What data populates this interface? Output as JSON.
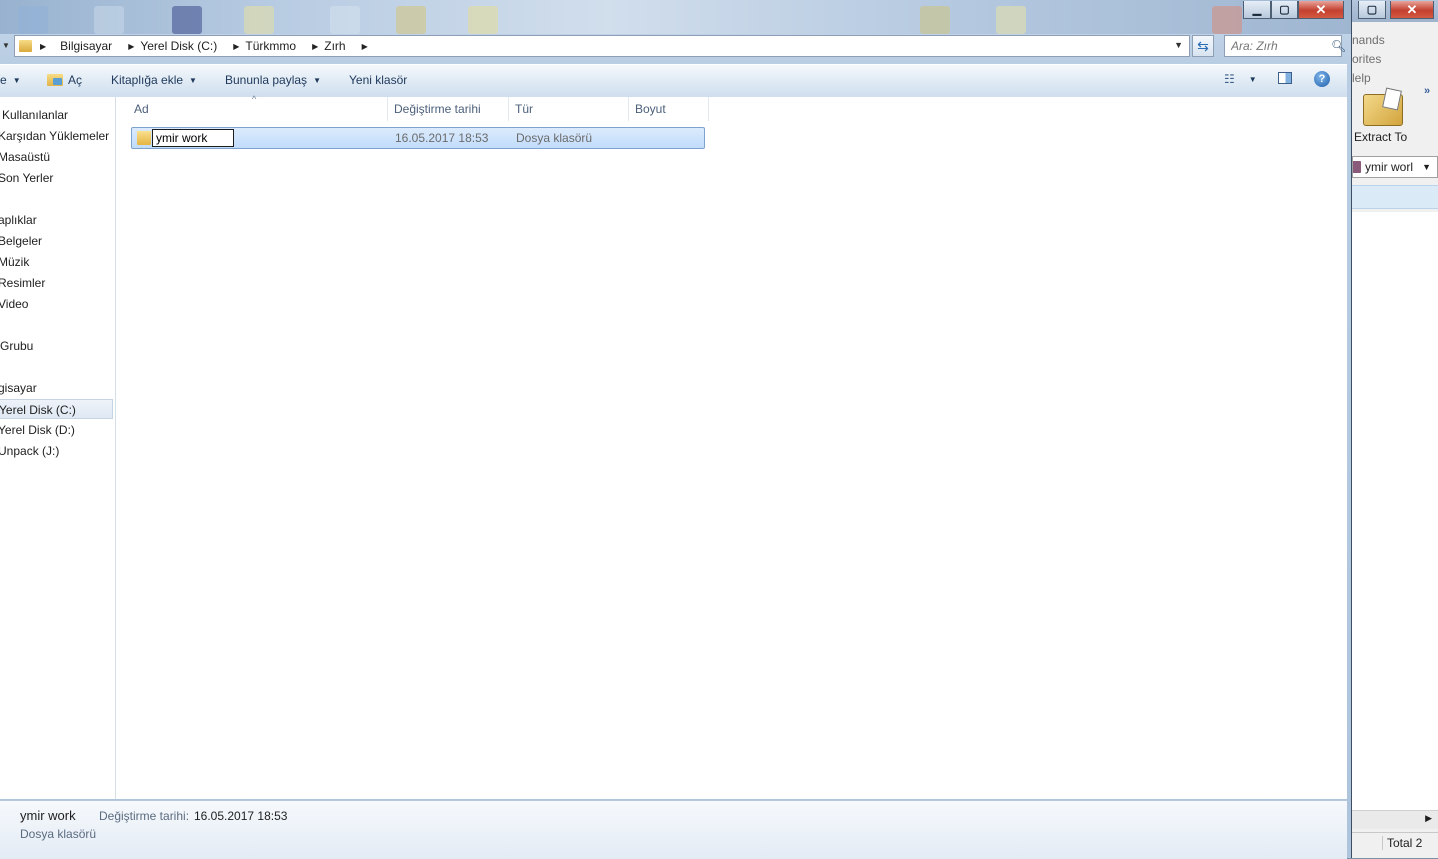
{
  "explorer": {
    "breadcrumb": [
      "Bilgisayar",
      "Yerel Disk (C:)",
      "Türkmmo",
      "Zırh"
    ],
    "search_placeholder": "Ara: Zırh",
    "commands": {
      "organize_label": "e",
      "open_label": "Aç",
      "add_library_label": "Kitaplığa ekle",
      "share_label": "Bununla paylaş",
      "new_folder_label": "Yeni klasör"
    },
    "nav": {
      "favorites": [
        "Kullanılanlar",
        "Karşıdan Yüklemeler",
        "Masaüstü",
        "Son Yerler"
      ],
      "libraries_header": "aplıklar",
      "libraries": [
        "Belgeler",
        "Müzik",
        "Resimler",
        "Video"
      ],
      "homegroup": "Grubu",
      "computer_header": "gisayar",
      "drives": [
        "Yerel Disk (C:)",
        "Yerel Disk (D:)",
        "Unpack (J:)"
      ]
    },
    "columns": {
      "name": "Ad",
      "modified": "Değiştirme tarihi",
      "type": "Tür",
      "size": "Boyut"
    },
    "rows": [
      {
        "name": "ymir work",
        "modified": "16.05.2017 18:53",
        "type": "Dosya klasörü",
        "size": ""
      }
    ],
    "details": {
      "name": "ymir work",
      "type": "Dosya klasörü",
      "modified_label": "Değiştirme tarihi:",
      "modified_value": "16.05.2017 18:53"
    }
  },
  "right_app": {
    "menu": [
      "nands",
      "orites",
      "lelp"
    ],
    "extract_label": "Extract To",
    "combo_value": "ymir worl",
    "status_total": "Total 2"
  },
  "icons": {
    "folder": "folder-icon",
    "search": "search-icon",
    "refresh": "refresh-icon",
    "help": "help-icon",
    "view": "view-options-icon",
    "preview": "preview-pane-icon"
  },
  "colors": {
    "selection": "#c1dcfc",
    "selection_border": "#7da2ce",
    "command_text": "#1e395b",
    "help_blue": "#2a6db5"
  }
}
